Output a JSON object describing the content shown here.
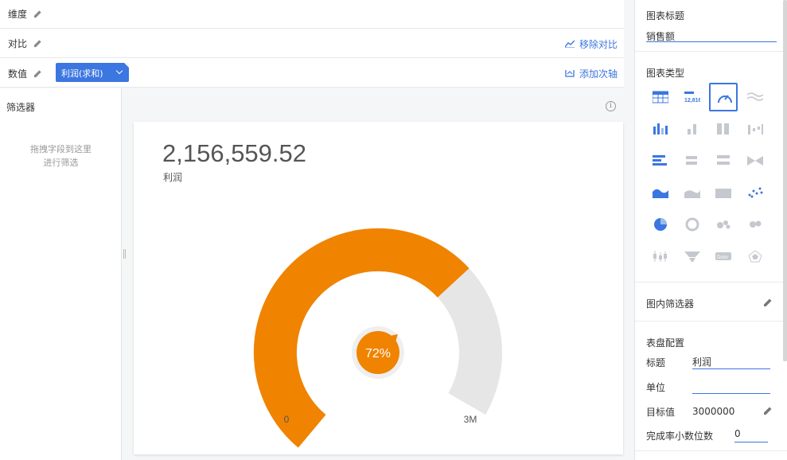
{
  "config": {
    "dimension_label": "维度",
    "compare_label": "对比",
    "value_label": "数值",
    "remove_compare": "移除对比",
    "add_secondary_axis": "添加次轴",
    "value_pill": "利润(求和)"
  },
  "filter": {
    "title": "筛选器",
    "hint_line1": "拖拽字段到这里",
    "hint_line2": "进行筛选"
  },
  "card": {
    "big_number": "2,156,559.52",
    "metric_label": "利润",
    "gauge_min": "0",
    "gauge_max": "3M",
    "percent_label": "72%",
    "percent_value": 0.72
  },
  "panel": {
    "chart_title_label": "图表标题",
    "chart_title_value": "销售额",
    "chart_type_label": "图表类型",
    "inner_filter_label": "图内筛选器",
    "gauge_config_label": "表盘配置",
    "title_key": "标题",
    "title_value": "利润",
    "unit_key": "单位",
    "unit_value": "",
    "target_key": "目标值",
    "target_value": "3000000",
    "decimals_key": "完成率小数位数",
    "decimals_value": "0"
  },
  "colors": {
    "accent": "#3b76e1",
    "gauge_fill": "#f08300",
    "gauge_track": "#e6e6e6"
  },
  "chart_types": [
    "table-icon",
    "kpi-number-icon",
    "gauge-icon",
    "wave-icon",
    "bar-chart-icon",
    "stacked-bar-icon",
    "grouped-bar-icon",
    "waterfall-icon",
    "horizontal-bar-icon",
    "horizontal-stacked-icon",
    "horizontal-grouped-icon",
    "bowtie-icon",
    "area-chart-icon",
    "stacked-area-icon",
    "percent-area-icon",
    "scatter-icon",
    "pie-chart-icon",
    "ring-chart-icon",
    "bubble-icon",
    "bubble-map-icon",
    "candlestick-icon",
    "funnel-icon",
    "word-cloud-icon",
    "radar-icon"
  ],
  "selected_chart_type": "gauge-icon"
}
